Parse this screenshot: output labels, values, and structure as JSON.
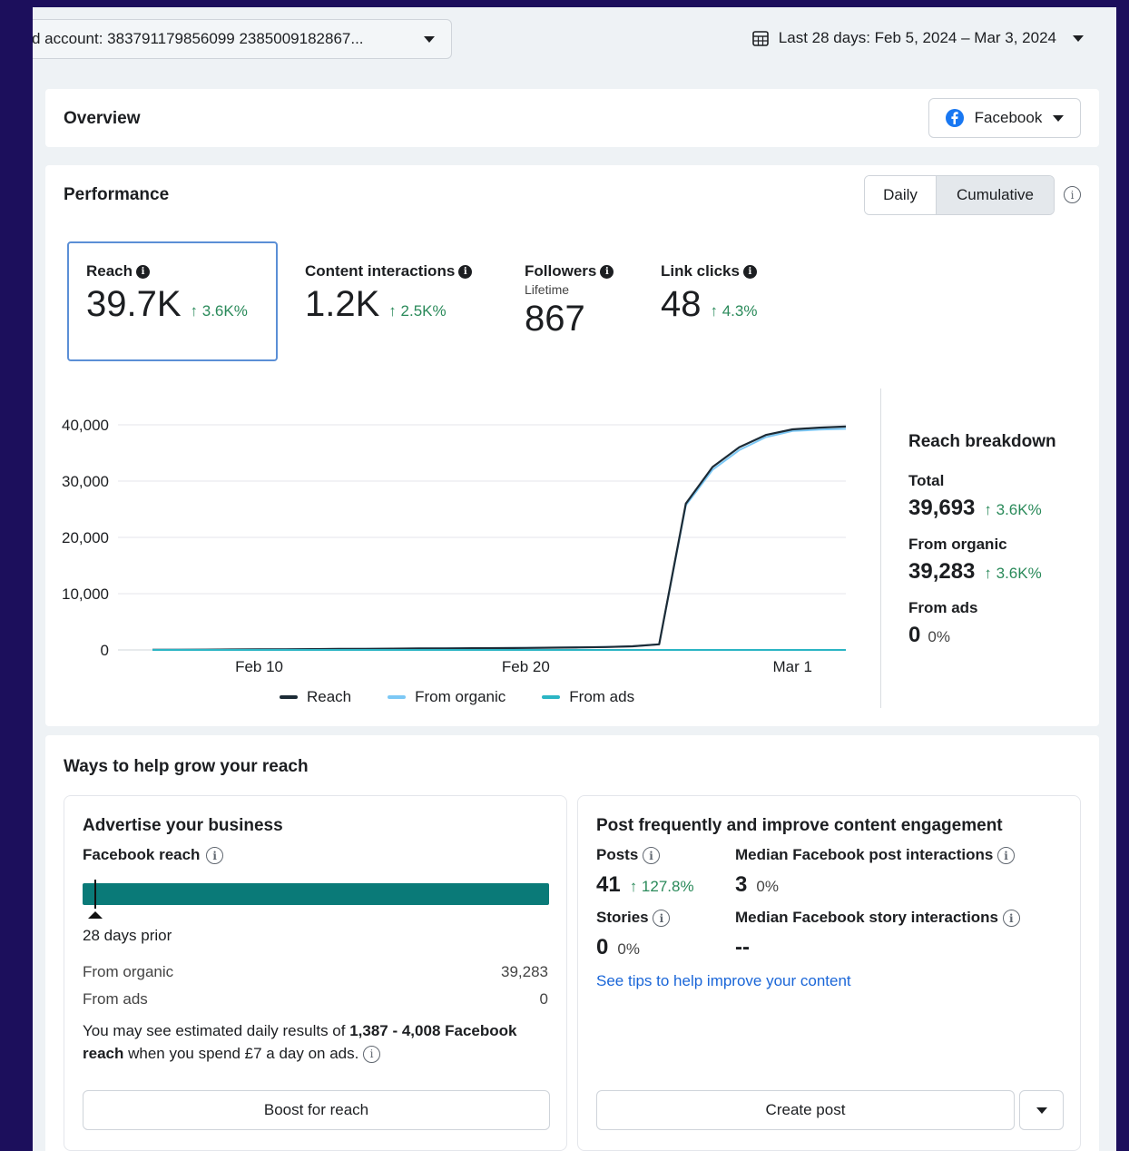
{
  "header": {
    "account_label": "d account: 383791179856099 2385009182867...",
    "date_range": "Last 28 days: Feb 5, 2024 – Mar 3, 2024"
  },
  "overview": {
    "title": "Overview",
    "platform": "Facebook"
  },
  "performance": {
    "title": "Performance",
    "toggle_daily": "Daily",
    "toggle_cumulative": "Cumulative",
    "metrics": [
      {
        "label": "Reach",
        "value": "39.7K",
        "delta": "↑ 3.6K%"
      },
      {
        "label": "Content interactions",
        "value": "1.2K",
        "delta": "↑ 2.5K%"
      },
      {
        "label": "Followers",
        "sub": "Lifetime",
        "value": "867"
      },
      {
        "label": "Link clicks",
        "value": "48",
        "delta": "↑ 4.3%"
      }
    ],
    "breakdown": {
      "title": "Reach breakdown",
      "total_label": "Total",
      "total_value": "39,693",
      "total_delta": "↑ 3.6K%",
      "organic_label": "From organic",
      "organic_value": "39,283",
      "organic_delta": "↑ 3.6K%",
      "ads_label": "From ads",
      "ads_value": "0",
      "ads_delta": "0%"
    }
  },
  "chart_data": {
    "type": "line",
    "y_tick_labels": [
      "0",
      "10,000",
      "20,000",
      "30,000",
      "40,000"
    ],
    "x_tick_labels": [
      "Feb 10",
      "Feb 20",
      "Mar 1"
    ],
    "ylim": [
      0,
      40000
    ],
    "grid": true,
    "legend_placement": "bottom",
    "x": [
      "2024-02-06",
      "2024-02-07",
      "2024-02-08",
      "2024-02-09",
      "2024-02-10",
      "2024-02-11",
      "2024-02-12",
      "2024-02-13",
      "2024-02-14",
      "2024-02-15",
      "2024-02-16",
      "2024-02-17",
      "2024-02-18",
      "2024-02-19",
      "2024-02-20",
      "2024-02-21",
      "2024-02-22",
      "2024-02-23",
      "2024-02-24",
      "2024-02-25",
      "2024-02-26",
      "2024-02-27",
      "2024-02-28",
      "2024-02-29",
      "2024-03-01",
      "2024-03-02",
      "2024-03-03"
    ],
    "series": [
      {
        "name": "Reach",
        "color": "#1c2b36",
        "values": [
          10,
          30,
          50,
          80,
          100,
          120,
          140,
          170,
          200,
          230,
          250,
          280,
          300,
          330,
          360,
          400,
          450,
          520,
          650,
          1000,
          26000,
          32500,
          36000,
          38200,
          39200,
          39500,
          39693
        ]
      },
      {
        "name": "From organic",
        "color": "#7cc8f5",
        "values": [
          10,
          30,
          50,
          80,
          100,
          120,
          140,
          170,
          200,
          230,
          250,
          280,
          300,
          330,
          360,
          400,
          450,
          520,
          650,
          1000,
          25700,
          32000,
          35500,
          37800,
          38900,
          39150,
          39283
        ]
      },
      {
        "name": "From ads",
        "color": "#2bb5c4",
        "values": [
          0,
          0,
          0,
          0,
          0,
          0,
          0,
          0,
          0,
          0,
          0,
          0,
          0,
          0,
          0,
          0,
          0,
          0,
          0,
          0,
          0,
          0,
          0,
          0,
          0,
          0,
          0
        ]
      }
    ]
  },
  "grow": {
    "title": "Ways to help grow your reach",
    "advertise": {
      "title": "Advertise your business",
      "reach_label": "Facebook reach",
      "prior_label": "28 days prior",
      "organic_label": "From organic",
      "organic_value": "39,283",
      "ads_label": "From ads",
      "ads_value": "0",
      "estimate_pre": "You may see estimated daily results of ",
      "estimate_bold1": "1,387 - 4,008 Facebook",
      "estimate_bold2": "reach",
      "estimate_post": " when you spend £7 a day on ads.",
      "bar_color": "#0a7a78",
      "marker_fraction": 0.027,
      "button": "Boost for reach"
    },
    "post": {
      "title": "Post frequently and improve content engagement",
      "posts_label": "Posts",
      "posts_value": "41",
      "posts_delta": "↑ 127.8%",
      "median_post_label": "Median Facebook post interactions",
      "median_post_value": "3",
      "median_post_delta": "0%",
      "stories_label": "Stories",
      "stories_value": "0",
      "stories_delta": "0%",
      "median_story_label": "Median Facebook story interactions",
      "median_story_value": "--",
      "tips_link": "See tips to help improve your content",
      "button": "Create post"
    }
  }
}
